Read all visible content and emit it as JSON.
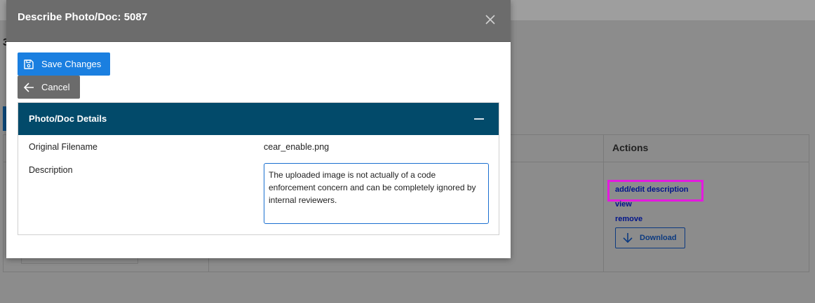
{
  "modal": {
    "title": "Describe Photo/Doc: 5087",
    "save_label": "Save Changes",
    "cancel_label": "Cancel"
  },
  "panel": {
    "title": "Photo/Doc Details",
    "fields": {
      "filename_label": "Original Filename",
      "filename_value": "cear_enable.png",
      "description_label": "Description",
      "description_value": "The uploaded image is not actually of a code enforcement concern and can be completely ignored by internal reviewers."
    }
  },
  "background": {
    "partial_digit": "3",
    "actions_header": "Actions",
    "actions": {
      "add_edit": "add/edit description",
      "view": "view",
      "remove": "remove",
      "download": "Download"
    }
  },
  "colors": {
    "primary": "#1a7fe0",
    "panel_header": "#024a6a",
    "highlight": "#e41adf",
    "link": "#00148a"
  },
  "icons": [
    "save-icon",
    "arrow-left-icon",
    "close-icon",
    "minus-icon",
    "arrow-down-icon"
  ]
}
